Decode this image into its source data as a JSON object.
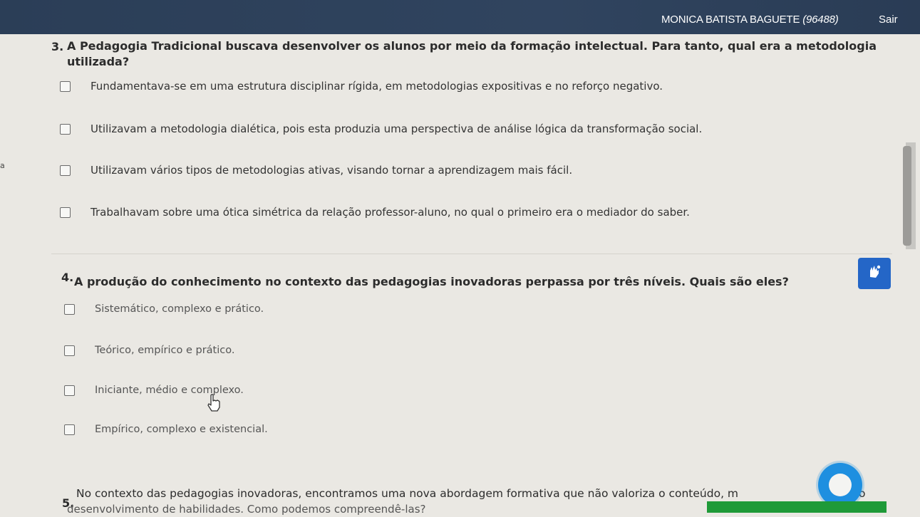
{
  "header": {
    "user_name": "MONICA BATISTA BAGUETE",
    "user_id": "(96488)",
    "logout_label": "Sair"
  },
  "questions": [
    {
      "number": "3.",
      "text_line1": "A Pedagogia Tradicional buscava desenvolver os alunos por meio da formação intelectual. Para tanto, qual era a metodologia",
      "text_line2": "utilizada?",
      "options": [
        "Fundamentava-se em uma estrutura disciplinar rígida, em metodologias expositivas e no reforço negativo.",
        "Utilizavam a metodologia dialética, pois esta produzia uma perspectiva de análise lógica da transformação social.",
        "Utilizavam vários tipos de metodologias ativas, visando tornar a aprendizagem mais fácil.",
        "Trabalhavam sobre uma ótica simétrica da relação professor-aluno, no qual o primeiro era o mediador do saber."
      ]
    },
    {
      "number": "4.",
      "text_line1": "A produção do conhecimento no contexto das pedagogias inovadoras perpassa por três níveis. Quais são eles?",
      "options": [
        "Sistemático, complexo e prático.",
        "Teórico, empírico e prático.",
        "Iniciante, médio e complexo.",
        "Empírico, complexo e existencial."
      ]
    },
    {
      "number": "5.",
      "text_line1": "No contexto das pedagogias inovadoras, encontramos uma nova abordagem formativa que não valoriza o conteúdo, m",
      "text_line1_end": "o",
      "text_line2": "desenvolvimento de habilidades. Como podemos compreendê-las?"
    }
  ],
  "left_marker": "a",
  "icons": {
    "accessibility": "sign-language-icon",
    "chat": "chat-icon",
    "cursor": "hand-pointer-icon"
  },
  "colors": {
    "header_bg": "#2b3e57",
    "accessibility_bg": "#2466c7",
    "chat_bg": "#1e8fe0",
    "green_bar": "#1f9a38"
  }
}
